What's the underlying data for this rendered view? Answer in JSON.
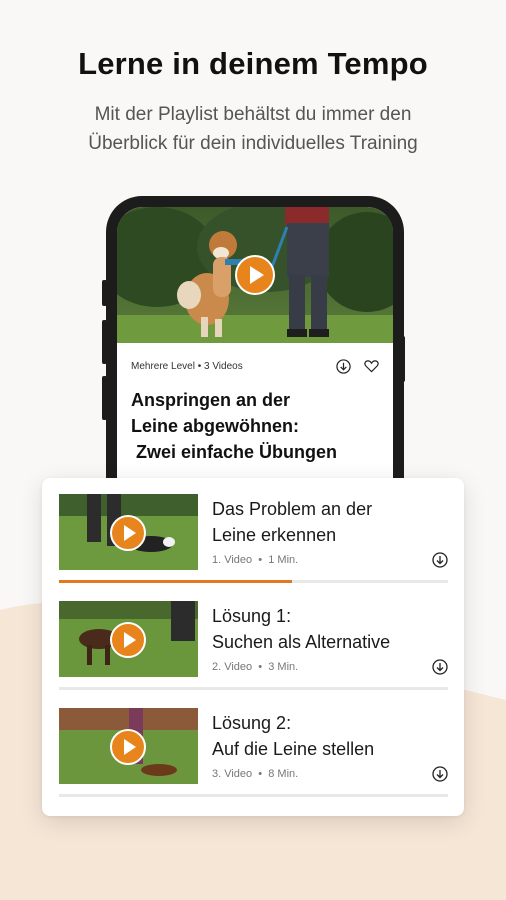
{
  "headline": "Lerne in deinem Tempo",
  "subline": [
    "Mit der Playlist behältst du immer den",
    "Überblick für dein individuelles Training"
  ],
  "colors": {
    "accent": "#e8841c",
    "background": "#faf8f6",
    "wave": "#f6e6d6"
  },
  "featured": {
    "meta": "Mehrere Level • 3 Videos",
    "title_lines": [
      "Anspringen an der",
      "Leine abgewöhnen:",
      " Zwei einfache Übungen"
    ],
    "icons": [
      "download-icon",
      "heart-icon",
      "play-icon"
    ]
  },
  "playlist": [
    {
      "title_lines": [
        "Das Problem an der",
        "Leine erkennen"
      ],
      "meta": "1. Video  •  1 Min.",
      "progress": 0.6
    },
    {
      "title_lines": [
        "Lösung 1:",
        "Suchen als Alternative"
      ],
      "meta": "2. Video  •  3 Min.",
      "progress": 0
    },
    {
      "title_lines": [
        "Lösung 2:",
        "Auf die Leine stellen"
      ],
      "meta": "3. Video  •  8 Min.",
      "progress": 0
    }
  ]
}
